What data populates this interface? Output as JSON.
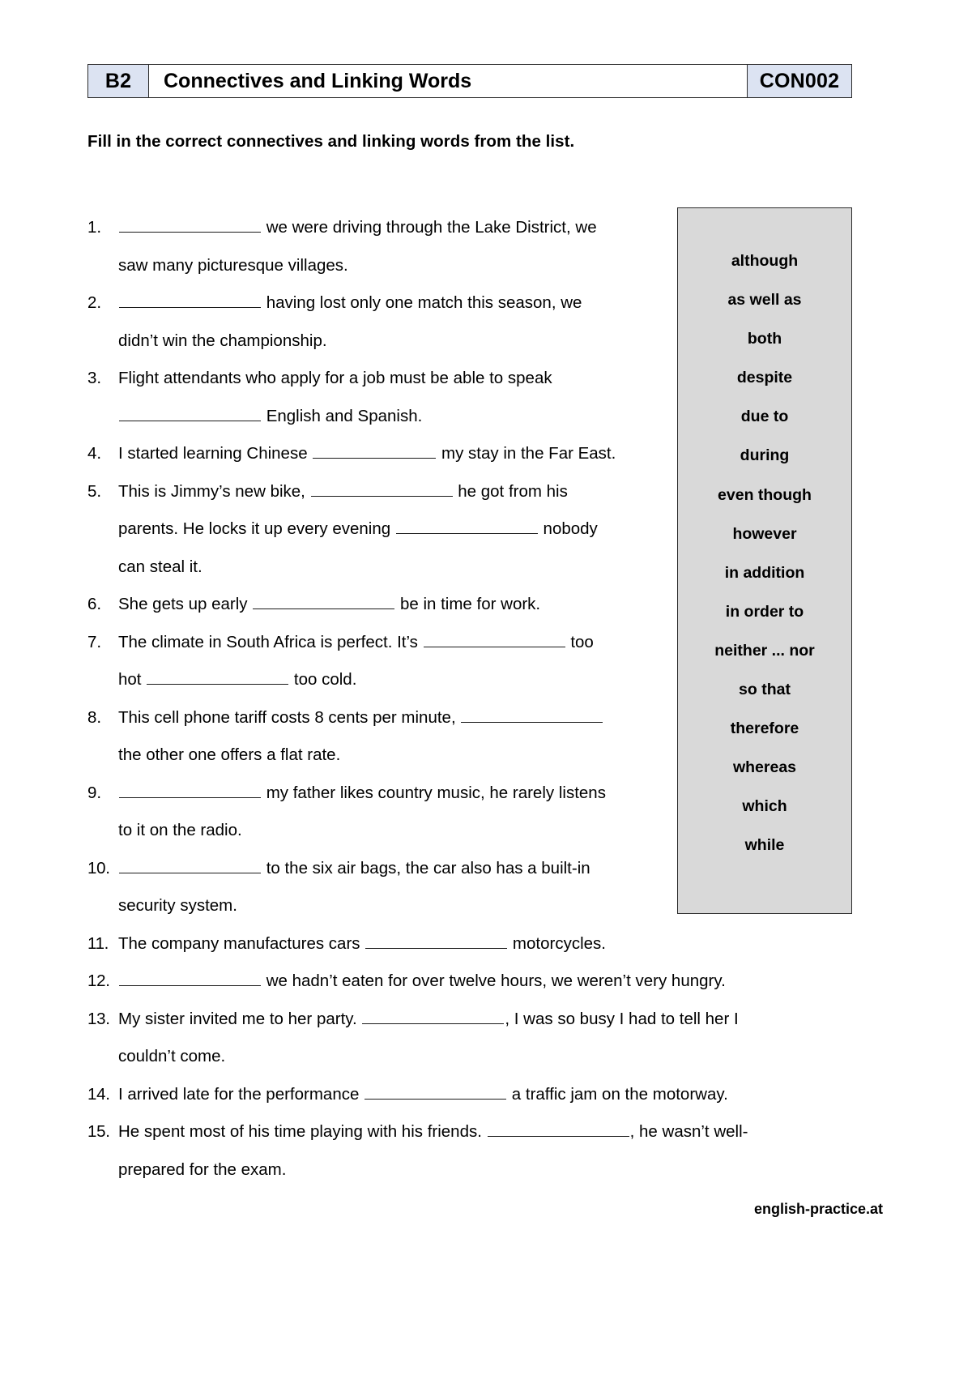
{
  "header": {
    "level": "B2",
    "title": "Connectives and Linking Words",
    "code": "CON002"
  },
  "instruction": "Fill in the correct connectives and linking words from the list.",
  "word_list": {
    "items": [
      "although",
      "as well as",
      "both",
      "despite",
      "due to",
      "during",
      "even though",
      "however",
      "in addition",
      "in order to",
      "neither ... nor",
      "so that",
      "therefore",
      "whereas",
      "which",
      "while"
    ]
  },
  "exercises": [
    {
      "number": "1.",
      "lines": [
        [
          {
            "type": "blank",
            "size": "lg"
          },
          {
            "type": "text",
            "value": " we were driving through the Lake District, we"
          }
        ],
        [
          {
            "type": "text",
            "value": "saw many picturesque villages."
          }
        ]
      ]
    },
    {
      "number": "2.",
      "lines": [
        [
          {
            "type": "blank",
            "size": "lg"
          },
          {
            "type": "text",
            "value": " having lost only one match this season, we"
          }
        ],
        [
          {
            "type": "text",
            "value": "didn’t win the championship."
          }
        ]
      ]
    },
    {
      "number": "3.",
      "lines": [
        [
          {
            "type": "text",
            "value": "Flight attendants who apply for a job must be able to speak"
          }
        ],
        [
          {
            "type": "blank",
            "size": "lg"
          },
          {
            "type": "text",
            "value": " English and Spanish."
          }
        ]
      ]
    },
    {
      "number": "4.",
      "lines": [
        [
          {
            "type": "text",
            "value": "I started learning Chinese "
          },
          {
            "type": "blank",
            "size": "md"
          },
          {
            "type": "text",
            "value": " my stay in the Far East."
          }
        ]
      ]
    },
    {
      "number": "5.",
      "lines": [
        [
          {
            "type": "text",
            "value": "This is Jimmy’s new bike, "
          },
          {
            "type": "blank",
            "size": "lg"
          },
          {
            "type": "text",
            "value": " he got from his"
          }
        ],
        [
          {
            "type": "text",
            "value": "parents. He locks it up every evening "
          },
          {
            "type": "blank",
            "size": "lg"
          },
          {
            "type": "text",
            "value": " nobody"
          }
        ],
        [
          {
            "type": "text",
            "value": "can steal it."
          }
        ]
      ]
    },
    {
      "number": "6.",
      "lines": [
        [
          {
            "type": "text",
            "value": "She gets up early "
          },
          {
            "type": "blank",
            "size": "lg"
          },
          {
            "type": "text",
            "value": " be in time for work."
          }
        ]
      ]
    },
    {
      "number": "7.",
      "lines": [
        [
          {
            "type": "text",
            "value": "The climate in South Africa is perfect. It’s "
          },
          {
            "type": "blank",
            "size": "lg"
          },
          {
            "type": "text",
            "value": " too"
          }
        ],
        [
          {
            "type": "text",
            "value": "hot "
          },
          {
            "type": "blank",
            "size": "lg"
          },
          {
            "type": "text",
            "value": " too cold."
          }
        ]
      ]
    },
    {
      "number": "8.",
      "lines": [
        [
          {
            "type": "text",
            "value": "This cell phone tariff costs 8 cents per minute, "
          },
          {
            "type": "blank",
            "size": "lg"
          }
        ],
        [
          {
            "type": "text",
            "value": "the other one offers a flat rate."
          }
        ]
      ]
    },
    {
      "number": "9.",
      "lines": [
        [
          {
            "type": "blank",
            "size": "lg"
          },
          {
            "type": "text",
            "value": " my father likes country music, he rarely listens"
          }
        ],
        [
          {
            "type": "text",
            "value": "to it on the radio."
          }
        ]
      ]
    },
    {
      "number": "10.",
      "lines": [
        [
          {
            "type": "blank",
            "size": "lg"
          },
          {
            "type": "text",
            "value": " to the six air bags, the car also has a built-in"
          }
        ],
        [
          {
            "type": "text",
            "value": "security system."
          }
        ]
      ]
    },
    {
      "number": "11.",
      "lines": [
        [
          {
            "type": "text",
            "value": "The company manufactures cars "
          },
          {
            "type": "blank",
            "size": "lg"
          },
          {
            "type": "text",
            "value": " motorcycles."
          }
        ]
      ]
    },
    {
      "number": "12.",
      "lines": [
        [
          {
            "type": "blank",
            "size": "lg"
          },
          {
            "type": "text",
            "value": " we hadn’t eaten for over twelve hours, we weren’t very hungry."
          }
        ]
      ]
    },
    {
      "number": "13.",
      "lines": [
        [
          {
            "type": "text",
            "value": "My sister invited me to her party. "
          },
          {
            "type": "blank",
            "size": "lg"
          },
          {
            "type": "text",
            "value": ", I was so busy I had to tell her I"
          }
        ],
        [
          {
            "type": "text",
            "value": "couldn’t come."
          }
        ]
      ]
    },
    {
      "number": "14.",
      "lines": [
        [
          {
            "type": "text",
            "value": "I arrived late for the performance "
          },
          {
            "type": "blank",
            "size": "lg"
          },
          {
            "type": "text",
            "value": " a traffic jam on the motorway."
          }
        ]
      ]
    },
    {
      "number": "15.",
      "lines": [
        [
          {
            "type": "text",
            "value": "He spent most of his time playing with his friends. "
          },
          {
            "type": "blank",
            "size": "lg"
          },
          {
            "type": "text",
            "value": ", he wasn’t well-"
          }
        ],
        [
          {
            "type": "text",
            "value": "prepared for the exam."
          }
        ]
      ]
    }
  ],
  "footer": {
    "source": "english-practice.at"
  }
}
